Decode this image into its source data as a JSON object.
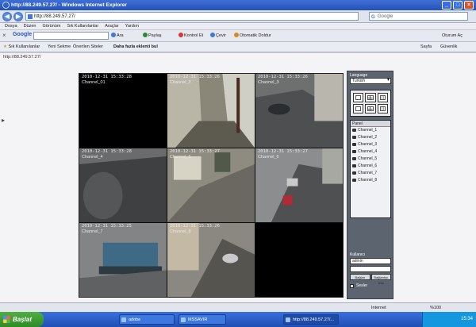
{
  "window": {
    "title": "http://88.249.57.27/ - Windows Internet Explorer",
    "address": "http://88.249.57.27/",
    "search_placeholder": "Google"
  },
  "menu": [
    "Dosya",
    "Düzen",
    "Görünüm",
    "Sık Kullanılanlar",
    "Araçlar",
    "Yardım"
  ],
  "google_toolbar": {
    "logo": "Google",
    "search_label": "Ara",
    "popup_label": "Paylaş",
    "check_label": "Kontrol Et",
    "translate_label": "Çevir",
    "autofill_label": "Otomatik Doldur",
    "signin_label": "Oturum Aç"
  },
  "favorites": {
    "favorites_label": "Sık Kullanılanlar",
    "items": [
      "Yeni Sekme",
      "Önerilen Siteler",
      "Daha fazla eklenti bul"
    ],
    "tab_label": "http://88.249.57.27/",
    "right_items": [
      "Sayfa",
      "Güvenlik"
    ]
  },
  "viewer": {
    "language_label": "Language",
    "language_value": "Turkish",
    "channel_list_header": "Panel",
    "channels": [
      "Channel_1",
      "Channel_2",
      "Channel_3",
      "Channel_4",
      "Channel_5",
      "Channel_6",
      "Channel_7",
      "Channel_8"
    ],
    "login": {
      "user_label": "Kullanıcı",
      "user_value": "admin",
      "password_value": "",
      "connect_label": "Bağlan",
      "disconnect_label": "Bağlantıyı Kes",
      "remember_label": "Sesler"
    },
    "cameras": [
      {
        "timestamp": "2010-12-31 15:33:28",
        "channel": "Channel_01"
      },
      {
        "timestamp": "2010-12-31 15:33:26",
        "channel": "Channel_2"
      },
      {
        "timestamp": "2010-12-31 15:33:26",
        "channel": "Channel_3"
      },
      {
        "timestamp": "2010-12-31 15:33:28",
        "channel": "Channel_4"
      },
      {
        "timestamp": "2010-12-31 15:33:27",
        "channel": "Channel_5"
      },
      {
        "timestamp": "2010-12-31 15:33:27",
        "channel": "Channel_6"
      },
      {
        "timestamp": "2010-12-31 15:33:25",
        "channel": "Channel_7"
      },
      {
        "timestamp": "2010-12-31 15:33:26",
        "channel": "Channel_8"
      },
      {
        "timestamp": "",
        "channel": ""
      }
    ]
  },
  "statusbar": {
    "zone": "Internet",
    "zoom": "%100"
  },
  "taskbar": {
    "start_label": "Başlat",
    "tasks": [
      "adobe",
      "MSSAVIR",
      "http://88.249.57.27/..."
    ],
    "clock": "15:34"
  },
  "colors": {
    "titlebar": "#2452b8",
    "selected_cam_border": "#d08a20",
    "panel_bg": "#5c6470"
  }
}
